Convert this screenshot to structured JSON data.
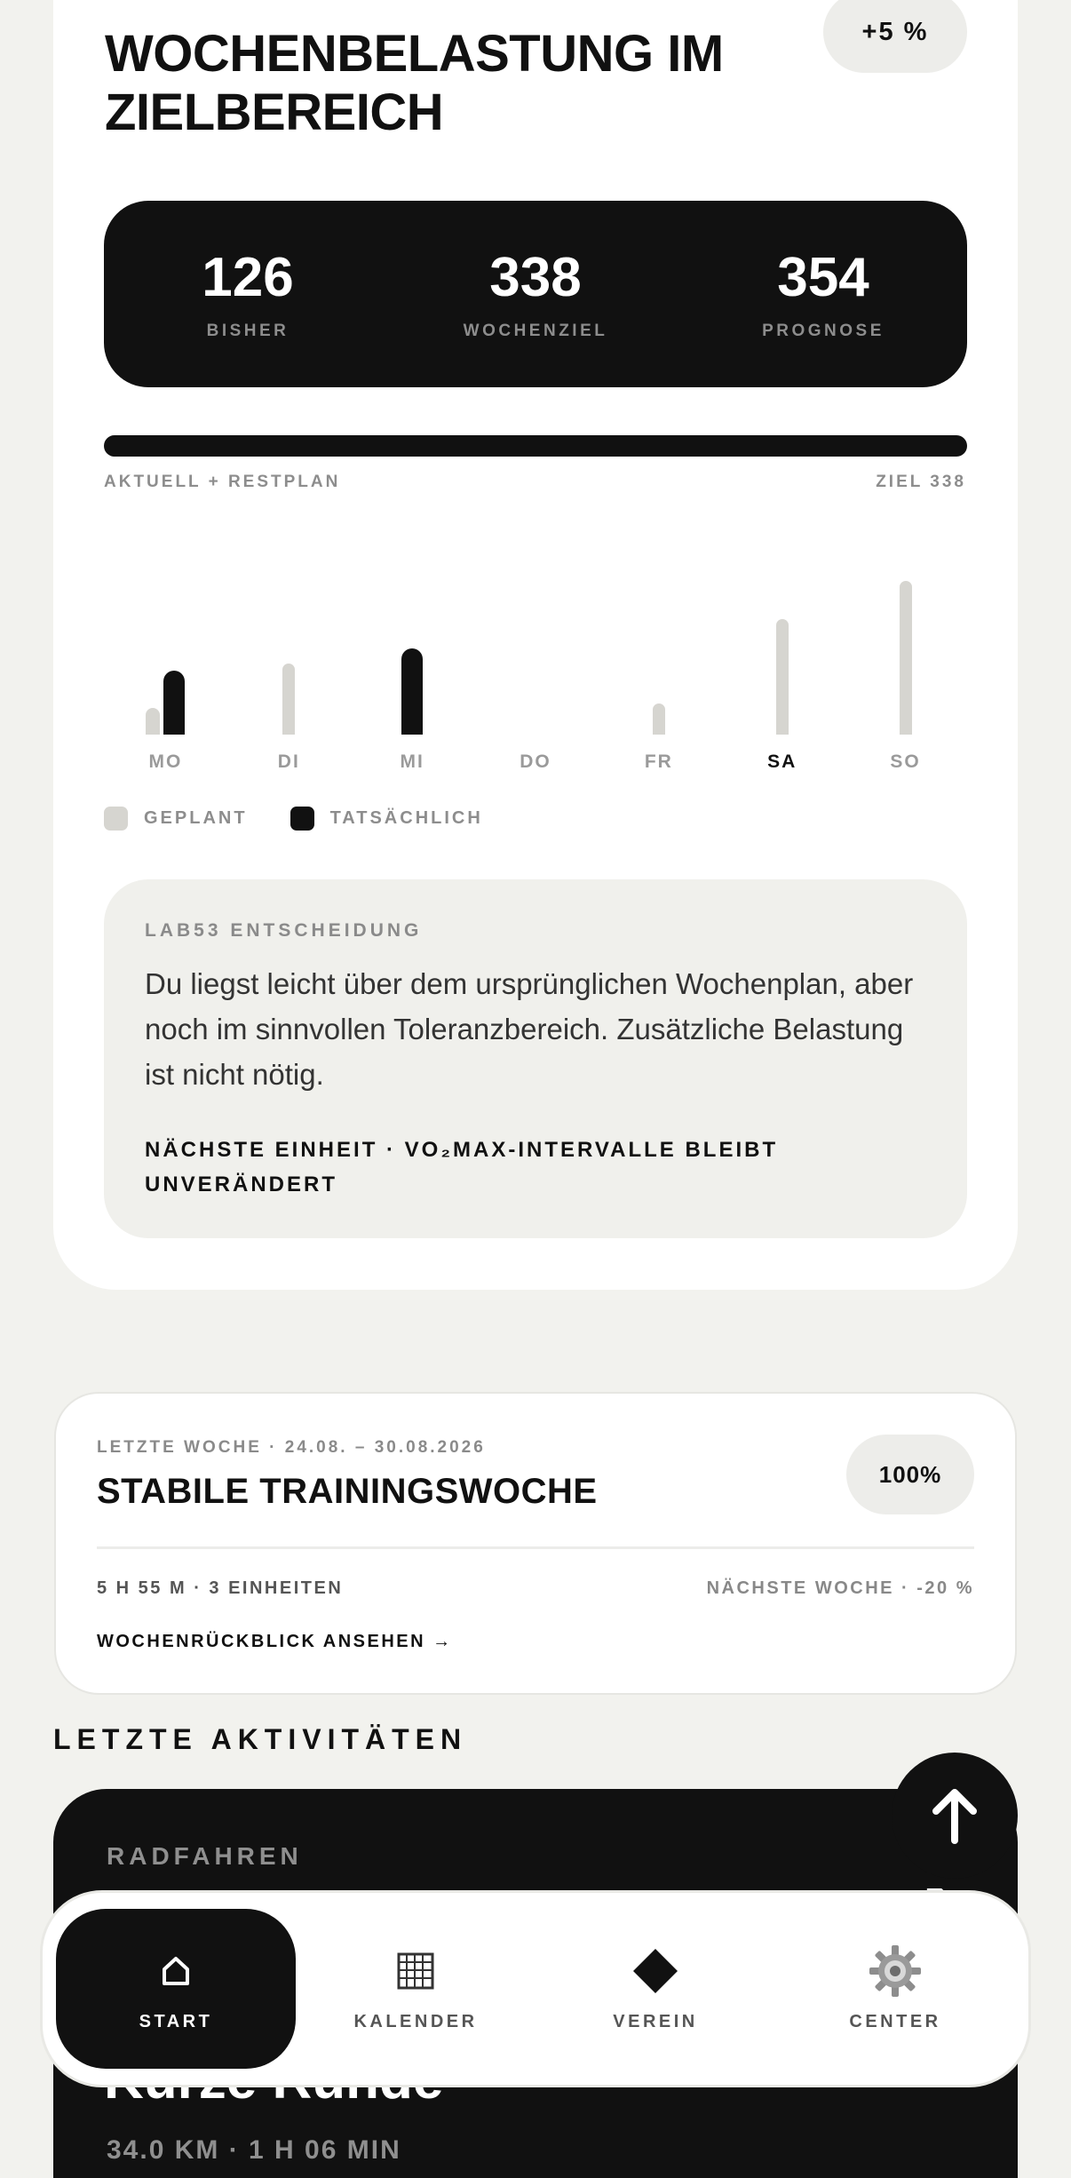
{
  "header": {
    "title": "WOCHENBELASTUNG IM ZIELBEREICH",
    "delta_badge": "+5 %"
  },
  "stats": [
    {
      "value": "126",
      "label": "BISHER"
    },
    {
      "value": "338",
      "label": "WOCHENZIEL"
    },
    {
      "value": "354",
      "label": "PROGNOSE"
    }
  ],
  "progress": {
    "left_label": "AKTUELL + RESTPLAN",
    "right_label": "ZIEL 338",
    "fraction": 1.0
  },
  "chart_data": {
    "type": "bar",
    "categories": [
      "MO",
      "DI",
      "MI",
      "DO",
      "FR",
      "SA",
      "SO"
    ],
    "active_category": "SA",
    "series": [
      {
        "name": "GEPLANT",
        "values": [
          30,
          80,
          0,
          0,
          35,
          130,
          173
        ]
      },
      {
        "name": "TATSÄCHLICH",
        "values": [
          72,
          0,
          97,
          0,
          0,
          0,
          0
        ]
      }
    ],
    "colors": {
      "plan": "#d6d5d0",
      "actual": "#111111"
    },
    "legend": "bottom-left"
  },
  "legend": {
    "planned": "GEPLANT",
    "actual": "TATSÄCHLICH"
  },
  "decision": {
    "label": "LAB53 ENTSCHEIDUNG",
    "text": "Du liegst leicht über dem ursprünglichen Wochenplan, aber noch im sinnvollen Toleranzbereich. Zusätzliche Belastung ist nicht nötig.",
    "next": "NÄCHSTE EINHEIT · VO₂MAX-INTERVALLE BLEIBT UNVERÄNDERT"
  },
  "last_week": {
    "range": "LETZTE WOCHE · 24.08. – 30.08.2026",
    "title": "STABILE TRAININGSWOCHE",
    "badge": "100%",
    "meta": "5 H 55 M · 3 EINHEITEN",
    "next_week": "NÄCHSTE WOCHE · -20 %",
    "link": "WOCHENRÜCKBLICK ANSEHEN →"
  },
  "activities": {
    "section_title": "LETZTE AKTIVITÄTEN",
    "items": [
      {
        "type": "RADFAHREN",
        "title": "Kurze Runde",
        "meta": "34.0 KM · 1 H 06 MIN"
      }
    ]
  },
  "tabbar": {
    "items": [
      {
        "label": "START",
        "icon": "home-icon",
        "active": true
      },
      {
        "label": "KALENDER",
        "icon": "calendar-icon",
        "active": false
      },
      {
        "label": "VEREIN",
        "icon": "diamond-icon",
        "active": false
      },
      {
        "label": "CENTER",
        "icon": "gear-icon",
        "active": false
      }
    ]
  }
}
